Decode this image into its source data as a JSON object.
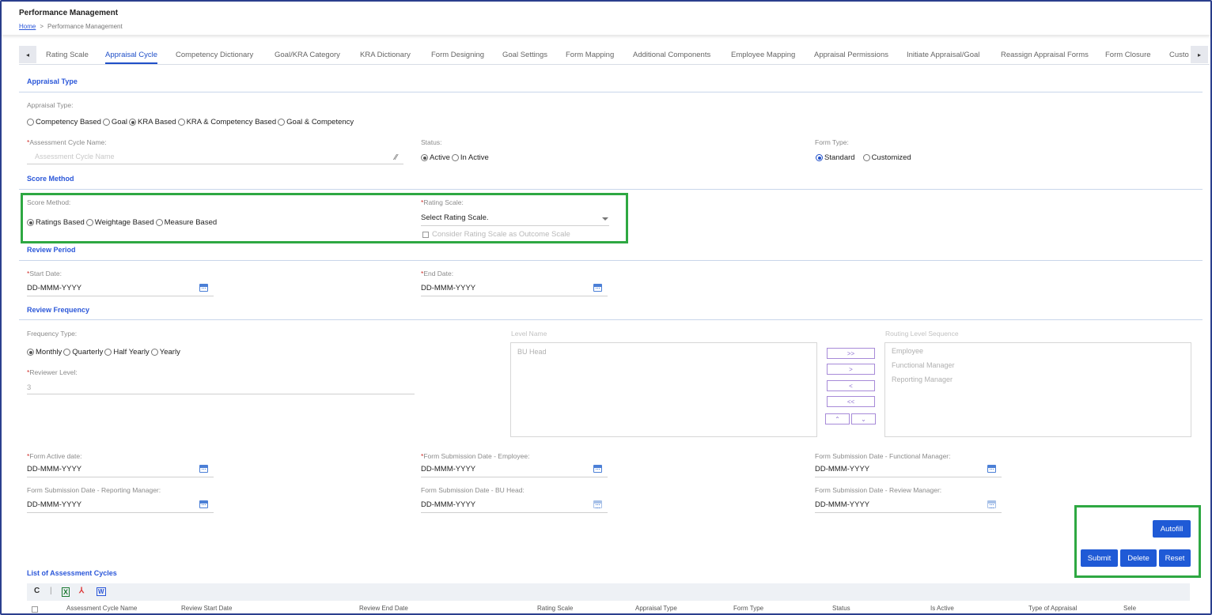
{
  "header": {
    "title": "Performance Management",
    "breadcrumb": {
      "home": "Home",
      "separator": ">",
      "current": "Performance Management"
    }
  },
  "tabs": {
    "left_arrow": "◂",
    "right_arrow": "▸",
    "items": [
      "Rating Scale",
      "Appraisal Cycle",
      "Competency Dictionary",
      "Goal/KRA Category",
      "KRA Dictionary",
      "Form Designing",
      "Goal Settings",
      "Form Mapping",
      "Additional Components",
      "Employee Mapping",
      "Appraisal Permissions",
      "Initiate Appraisal/Goal",
      "Reassign Appraisal Forms",
      "Form Closure",
      "Custo"
    ],
    "active": "Appraisal Cycle"
  },
  "appraisal_type": {
    "section_title": "Appraisal Type",
    "label": "Appraisal Type:",
    "options": [
      "Competency Based",
      "Goal",
      "KRA Based",
      "KRA & Competency Based",
      "Goal & Competency"
    ],
    "selected": "KRA Based",
    "cycle_name_label": "Assessment Cycle Name:",
    "cycle_name_placeholder": "Assessment Cycle Name",
    "status_label": "Status:",
    "status_options": [
      "Active",
      "In Active"
    ],
    "status_selected": "Active",
    "form_type_label": "Form Type:",
    "form_type_options": [
      "Standard",
      "Customized"
    ],
    "form_type_selected": "Standard",
    "required_mark": "*"
  },
  "score_method": {
    "section_title": "Score Method",
    "label": "Score Method:",
    "options": [
      "Ratings Based",
      "Weightage Based",
      "Measure Based"
    ],
    "selected": "Ratings Based",
    "rating_scale_label": "Rating Scale:",
    "rating_scale_value": "Select Rating Scale.",
    "consider_label": "Consider Rating Scale as Outcome Scale"
  },
  "review_period": {
    "section_title": "Review Period",
    "start_label": "Start Date:",
    "start_value": "DD-MMM-YYYY",
    "end_label": "End Date:",
    "end_value": "DD-MMM-YYYY"
  },
  "review_frequency": {
    "section_title": "Review Frequency",
    "frequency_label": "Frequency Type:",
    "frequency_options": [
      "Monthly",
      "Quarterly",
      "Half Yearly",
      "Yearly"
    ],
    "frequency_selected": "Monthly",
    "reviewer_level_label": "Reviewer Level:",
    "reviewer_level_value": "3",
    "level_name_label": "Level Name",
    "level_names": [
      "BU Head"
    ],
    "routing_label": "Routing Level Sequence",
    "routing_levels": [
      "Employee",
      "Functional Manager",
      "Reporting Manager"
    ],
    "move_buttons": [
      ">>",
      ">",
      "<",
      "<<"
    ],
    "up_label": "⌃",
    "down_label": "⌄"
  },
  "form_dates": {
    "active_label": "Form Active date:",
    "active_value": "DD-MMM-YYYY",
    "employee_label": "Form Submission Date - Employee:",
    "employee_value": "DD-MMM-YYYY",
    "functional_label": "Form Submission Date - Functional Manager:",
    "functional_value": "DD-MMM-YYYY",
    "reporting_label": "Form Submission Date - Reporting Manager:",
    "reporting_value": "DD-MMM-YYYY",
    "bu_head_label": "Form Submission Date - BU Head:",
    "bu_head_value": "DD-MMM-YYYY",
    "review_label": "Form Submission Date - Review Manager:",
    "review_value": "DD-MMM-YYYY"
  },
  "actions": {
    "autofill": "Autofill",
    "submit": "Submit",
    "delete": "Delete",
    "reset": "Reset"
  },
  "list": {
    "section_title": "List of Assessment Cycles",
    "toolbar": {
      "refresh": "C",
      "divider": "|",
      "excel": "X",
      "pdf": "⅄",
      "word": "W"
    },
    "columns": [
      "Assessment Cycle Name",
      "Review Start Date",
      "Review End Date",
      "Rating Scale",
      "Appraisal Type",
      "Form Type",
      "Status",
      "Is Active",
      "Type of Appraisal",
      "Sele"
    ]
  },
  "colors": {
    "accent": "#1f4fc8",
    "button": "#1f5ad6",
    "highlight_box": "#2ea842",
    "frame": "#2b3f8e"
  }
}
